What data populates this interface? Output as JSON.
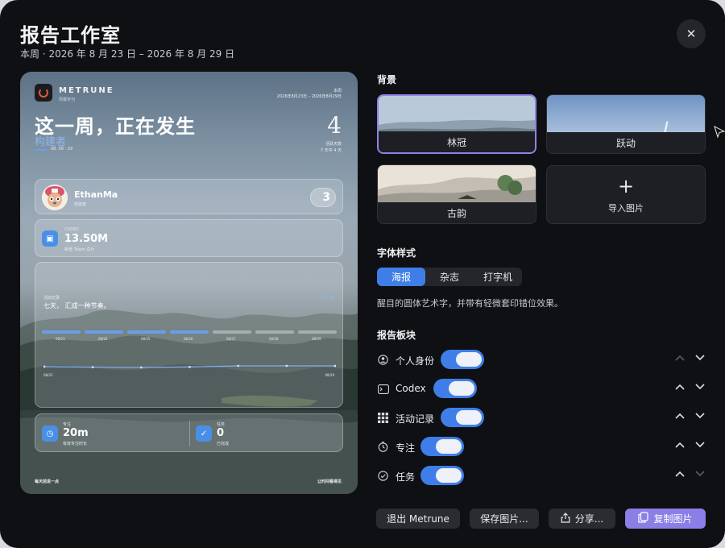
{
  "header": {
    "title": "报告工作室",
    "subtitle": "本周 · 2026 年 8 月 23 日 – 2026 年 8 月 29 日",
    "close_icon": "close-icon"
  },
  "poster": {
    "brand": "METRUNE",
    "brand_sub": "周报专刊",
    "week_label": "本周",
    "date_range": "2026年8月23日 – 2026年8月29日",
    "headline": "这一周，正在发生",
    "builder": "构建者",
    "builder_date": "08. 08 · 29",
    "big_number": "4",
    "big_number_label1": "活跃天数",
    "big_number_label2": "7 天中 4 天",
    "user": {
      "name": "EthanMa",
      "role": "构建者",
      "count": "3"
    },
    "codex": {
      "label": "CODEX",
      "value": "13.50M",
      "sub": "新增 Token 总计"
    },
    "activity": {
      "section": "活动记录",
      "tag": "本周节奏",
      "line": "七天， 汇成一种节奏。",
      "days": [
        "08/23",
        "08/24",
        "08/25",
        "08/26",
        "08/27",
        "08/28",
        "08/29"
      ],
      "active": [
        true,
        true,
        true,
        true,
        false,
        false,
        false
      ],
      "series_line": [
        0.55,
        0.52,
        0.5,
        0.53,
        0.6,
        0.6,
        0.6
      ],
      "line_start": "08/23",
      "line_end": "08/29"
    },
    "focus": {
      "label": "专注",
      "value": "20m",
      "sub": "有效专注时长"
    },
    "tasks": {
      "label": "任务",
      "value": "0",
      "sub": "已完成"
    },
    "footer_left": "每天前进一点",
    "footer_right": "让时间看得见"
  },
  "background": {
    "title": "背景",
    "options": [
      {
        "label": "林冠",
        "selected": true
      },
      {
        "label": "跃动",
        "selected": false
      },
      {
        "label": "古韵",
        "selected": false
      }
    ],
    "import_label": "导入图片",
    "import_icon": "plus-icon"
  },
  "font_style": {
    "title": "字体样式",
    "options": [
      "海报",
      "杂志",
      "打字机"
    ],
    "active": "海报",
    "description": "醒目的圆体艺术字，并带有轻微套印错位效果。"
  },
  "modules": {
    "title": "报告板块",
    "items": [
      {
        "label": "个人身份",
        "icon": "person-icon",
        "enabled": true,
        "up_enabled": false,
        "down_enabled": true
      },
      {
        "label": "Codex",
        "icon": "terminal-icon",
        "enabled": true,
        "up_enabled": true,
        "down_enabled": true
      },
      {
        "label": "活动记录",
        "icon": "grid-icon",
        "enabled": true,
        "up_enabled": true,
        "down_enabled": true
      },
      {
        "label": "专注",
        "icon": "timer-icon",
        "enabled": true,
        "up_enabled": true,
        "down_enabled": true
      },
      {
        "label": "任务",
        "icon": "check-circle-icon",
        "enabled": true,
        "up_enabled": true,
        "down_enabled": false
      }
    ]
  },
  "actions": {
    "quit": "退出 Metrune",
    "save": "保存图片...",
    "share": "分享...",
    "copy": "复制图片"
  },
  "colors": {
    "accent": "#3f7ee8",
    "primary_button": "#8a7fe6",
    "selected_border": "#8f82e8"
  }
}
